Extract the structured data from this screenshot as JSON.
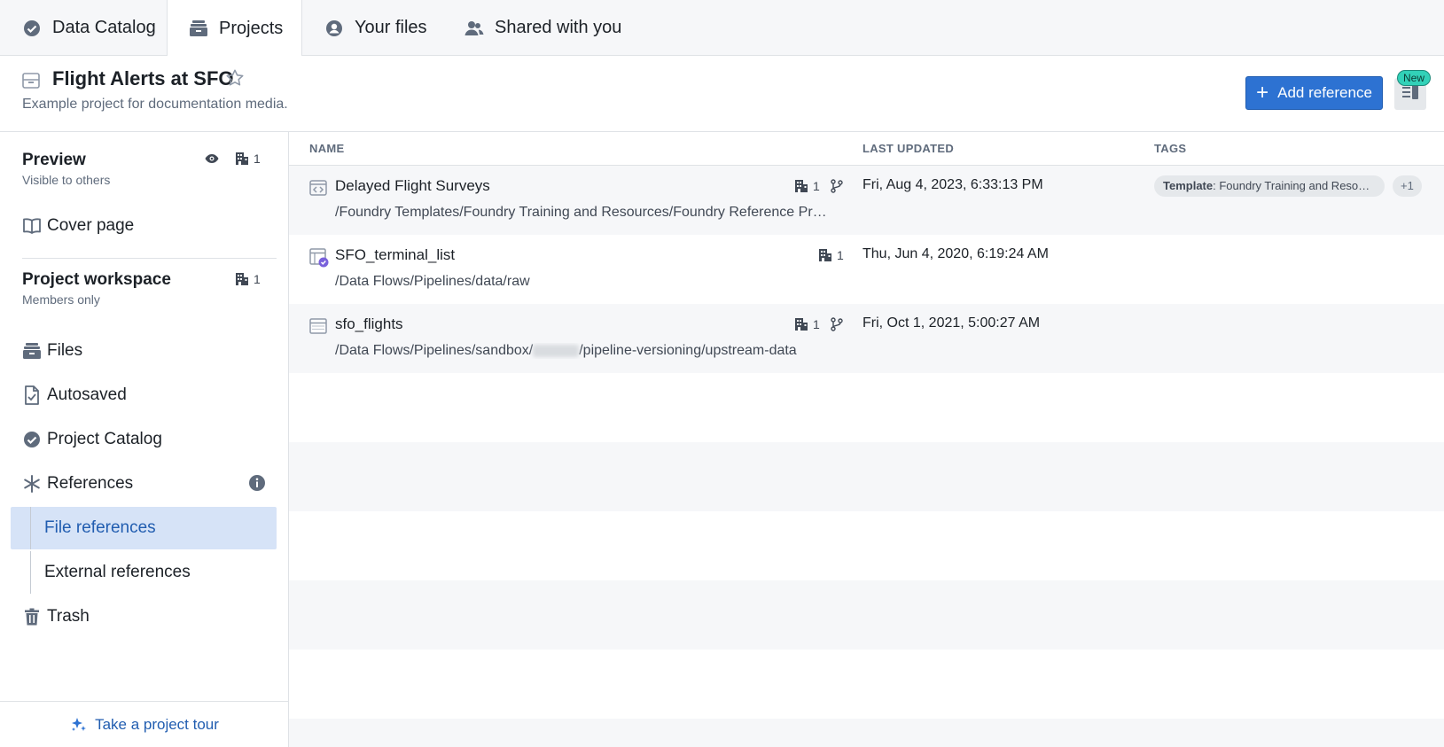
{
  "tabs": [
    {
      "label": "Data Catalog",
      "icon": "check-circle-icon"
    },
    {
      "label": "Projects",
      "icon": "projects-icon",
      "active": true
    },
    {
      "label": "Your files",
      "icon": "user-circle-icon"
    },
    {
      "label": "Shared with you",
      "icon": "people-icon"
    }
  ],
  "header": {
    "title": "Flight Alerts at SFO",
    "description": "Example project for documentation media.",
    "add_reference_label": "Add reference",
    "new_badge": "New"
  },
  "sidebar": {
    "preview": {
      "title": "Preview",
      "subtitle": "Visible to others",
      "count": "1"
    },
    "cover_page": "Cover page",
    "workspace": {
      "title": "Project workspace",
      "subtitle": "Members only",
      "count": "1"
    },
    "items": [
      {
        "label": "Files",
        "icon": "files-icon"
      },
      {
        "label": "Autosaved",
        "icon": "autosaved-icon"
      },
      {
        "label": "Project Catalog",
        "icon": "check-circle-icon"
      },
      {
        "label": "References",
        "icon": "asterisk-icon"
      },
      {
        "label": "File references",
        "icon": ""
      },
      {
        "label": "External references",
        "icon": ""
      },
      {
        "label": "Trash",
        "icon": "trash-icon"
      }
    ],
    "tour_label": "Take a project tour"
  },
  "table": {
    "columns": [
      "NAME",
      "LAST UPDATED",
      "TAGS"
    ],
    "rows": [
      {
        "name": "Delayed Flight Surveys",
        "path": "/Foundry Templates/Foundry Training and Resources/Foundry Reference Project",
        "org_count": "1",
        "has_branch": true,
        "updated": "Fri, Aug 4, 2023, 6:33:13 PM",
        "tag_key": "Template",
        "tag_value": "Foundry Training and Resources",
        "tag_more": "+1"
      },
      {
        "name": "SFO_terminal_list",
        "path": "/Data Flows/Pipelines/data/raw",
        "org_count": "1",
        "has_branch": false,
        "updated": "Thu, Jun 4, 2020, 6:19:24 AM"
      },
      {
        "name": "sfo_flights",
        "path_prefix": "/Data Flows/Pipelines/sandbox/",
        "path_suffix": "/pipeline-versioning/upstream-data",
        "org_count": "1",
        "has_branch": true,
        "updated": "Fri, Oct 1, 2021, 5:00:27 AM"
      }
    ]
  },
  "colors": {
    "primary": "#2d72d2",
    "selected_bg": "#d6e3f7",
    "selected_text": "#215db0",
    "badge": "#32d1b8"
  }
}
